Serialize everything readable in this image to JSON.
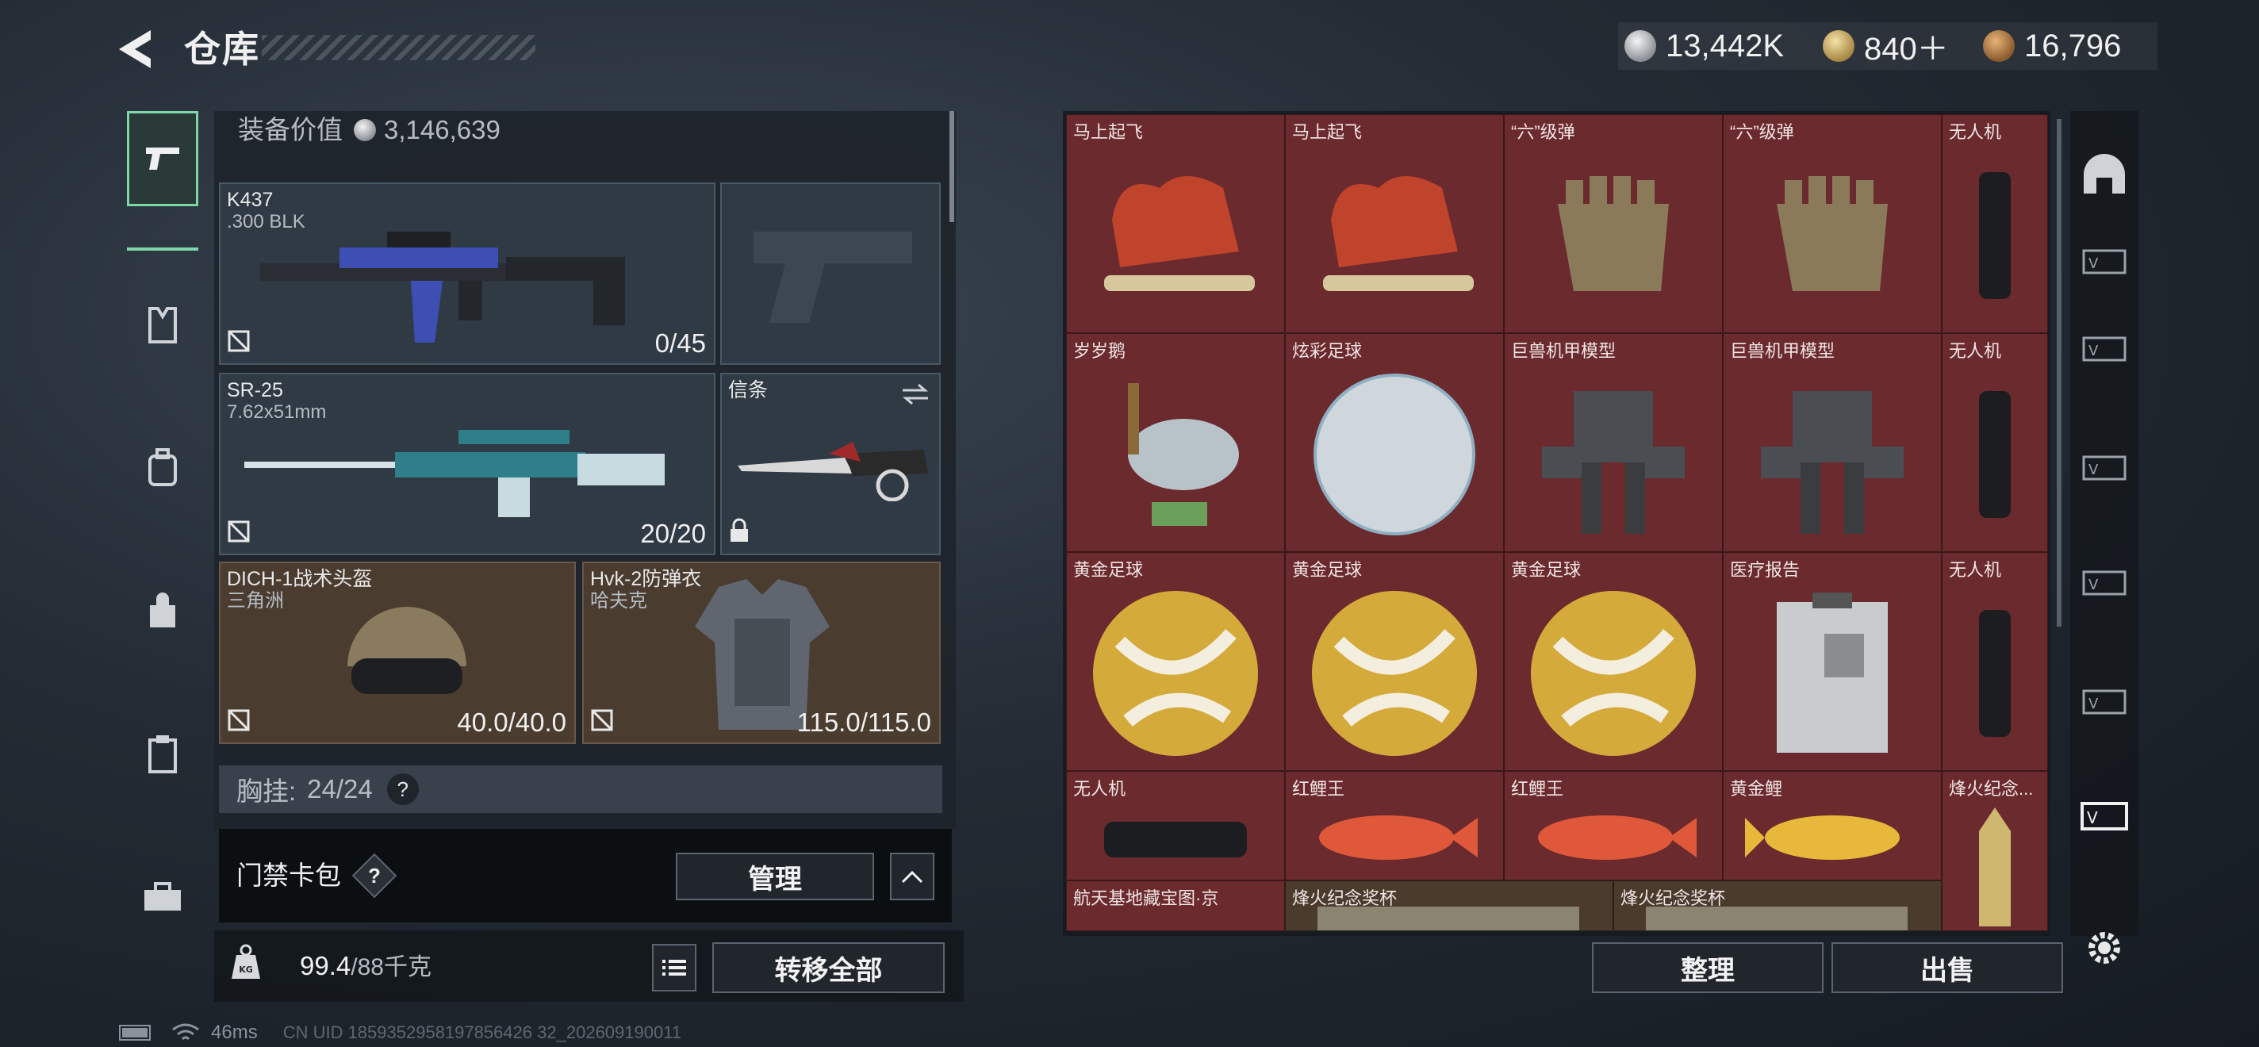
{
  "header": {
    "title": "仓库",
    "currencies": [
      {
        "icon": "silver-coin-icon",
        "value": "13,442K"
      },
      {
        "icon": "gold-triangle-coin-icon",
        "value": "840＋"
      },
      {
        "icon": "bronze-coin-icon",
        "value": "16,796"
      }
    ]
  },
  "left_nav": {
    "items": [
      {
        "icon": "pistol-icon",
        "active": true
      },
      {
        "icon": "armor-vest-icon",
        "active": false
      },
      {
        "icon": "backpack-icon",
        "active": false
      },
      {
        "icon": "bag-icon",
        "active": false
      },
      {
        "icon": "clipboard-icon",
        "active": false
      },
      {
        "icon": "toolbox-icon",
        "active": false
      }
    ]
  },
  "loadout": {
    "equip_value_label": "装备价值",
    "equip_value": "3,146,639",
    "primary": {
      "name": "K437",
      "ammo_type": ".300 BLK",
      "count": "0/45"
    },
    "secondary": {
      "name": "SR-25",
      "ammo_type": "7.62x51mm",
      "count": "20/20"
    },
    "melee": {
      "name": "信条"
    },
    "helmet": {
      "name": "DICH-1战术头盔",
      "sub": "三角洲",
      "durability": "40.0/40.0"
    },
    "armor": {
      "name": "Hvk-2防弹衣",
      "sub": "哈夫克",
      "durability": "115.0/115.0"
    },
    "chest_rig": {
      "label": "胸挂:",
      "value": "24/24",
      "help": "?"
    }
  },
  "keycard": {
    "label": "门禁卡包",
    "help": "?",
    "manage_button": "管理",
    "collapse_icon": "chevron-up-icon"
  },
  "weight": {
    "value": "99.4",
    "capacity": "/88千克",
    "transfer_button": "转移全部",
    "list_icon": "list-icon"
  },
  "storage": {
    "rows": [
      [
        "马上起飞",
        "马上起飞",
        "“六”级弹",
        "“六”级弹",
        "无人机"
      ],
      [
        "岁岁鹅",
        "炫彩足球",
        "巨兽机甲模型",
        "巨兽机甲模型",
        "无人机"
      ],
      [
        "黄金足球",
        "黄金足球",
        "黄金足球",
        "医疗报告",
        "无人机"
      ],
      [
        "无人机",
        "红鲤王",
        "红鲤王",
        "黄金鲤",
        "烽火纪念..."
      ],
      [
        "航天基地藏宝图·京",
        "烽火纪念奖杯",
        "烽火纪念奖杯"
      ]
    ],
    "sort_button": "整理",
    "sell_button": "出售"
  },
  "status": {
    "ping": "46ms",
    "uid": "CN UID 1859352958197856426 32_202609190011"
  },
  "colors": {
    "accent": "#7fd6a8",
    "cell_red": "#6b2a2e",
    "cell_brown": "#4a3b2c"
  }
}
